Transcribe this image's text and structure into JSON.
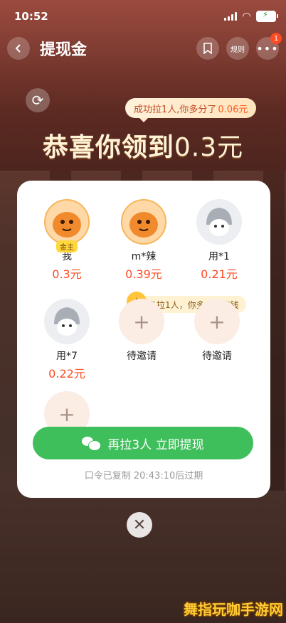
{
  "status_bar": {
    "time": "10:52",
    "battery_icon": "battery-charging-icon"
  },
  "header": {
    "title": "提现金",
    "rules_label": "规则",
    "notification_count": "1"
  },
  "banner": {
    "bubble_prefix": "成功拉1人,你多分了",
    "bubble_amount": "0.06元",
    "congrats_text": "恭喜你领到",
    "congrats_amount": "0.3元"
  },
  "members": [
    {
      "name": "我",
      "amount": "0.3元",
      "tag": "金主",
      "avatar": "orange-mascot"
    },
    {
      "name": "m*辣",
      "amount": "0.39元",
      "tag": "",
      "avatar": "orange-mascot"
    },
    {
      "name": "用*1",
      "amount": "0.21元",
      "tag": "",
      "avatar": "gray-mascot"
    },
    {
      "name": "用*7",
      "amount": "0.22元",
      "tag": "",
      "avatar": "gray-mascot"
    },
    {
      "name": "待邀请",
      "amount": "",
      "tag": "",
      "avatar": "empty-slot"
    },
    {
      "name": "待邀请",
      "amount": "",
      "tag": "",
      "avatar": "empty-slot"
    }
  ],
  "tip": "多拉1人，你多分一笔钱",
  "cta_label": "再拉3人 立即提现",
  "expiry_text": "口令已复制 20:43:10后过期",
  "watermark": "舞指玩咖手游网",
  "colors": {
    "accent_green": "#3fbf5b",
    "accent_red": "#ff4a22"
  }
}
